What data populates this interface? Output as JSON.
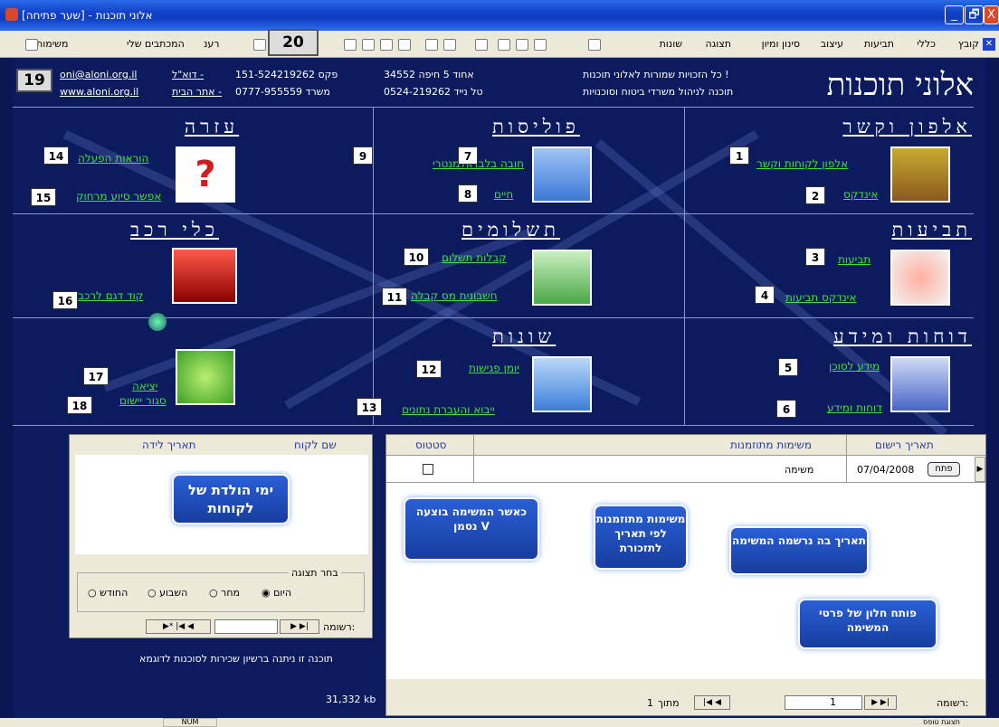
{
  "window": {
    "title": "[אלוני תוכנות - [שער פתיחה",
    "btn_min": "_",
    "btn_restore": "🗗",
    "btn_close": "X"
  },
  "toolbar": {
    "items": [
      "קובץ",
      "כללי",
      "תביעות",
      "עיצוב",
      "סינון ומיון",
      "תצוגה",
      "שונות"
    ],
    "my_forms": "המכתבים שלי",
    "reminders": "רענ",
    "tasks": "משימות",
    "badge20": "20",
    "badge19": "19"
  },
  "header": {
    "brand": "אלוני תוכנות",
    "slogan1": "כל הזכויות שמורות לאלוני תוכנות !",
    "slogan2": "תוכנה לניהול משרדי ביטוח וסוכנויות",
    "addr": "אחוד 5 חיפה  34552",
    "mobile": "טל נייד  0524-219262",
    "fax": "פקס  151-524219262",
    "office": "משרד  0777-955559",
    "email_lbl": "דוא\"ל -",
    "email": "oni@aloni.org.il",
    "site_lbl": "אתר הבית -",
    "site": "www.aloni.org.il"
  },
  "sections": {
    "alphon": {
      "title": "אלפון וקשר",
      "l1": "אלפון לקוחות וקשר",
      "l2": "אינדקס"
    },
    "policies": {
      "title": "פוליסות",
      "l1": "אלמנטרי",
      "l1b": "חובה בלבד",
      "l2": "חיים"
    },
    "help": {
      "title": "עזרה",
      "l1": "הוראות הפעלה",
      "l2": "אפשר סיוע מרחוק"
    },
    "claims": {
      "title": "תביעות",
      "l1": "תביעות",
      "l2": "אינדקס תביעות"
    },
    "payments": {
      "title": "תשלומים",
      "l1": "קבלות תשלום",
      "l2": "חשבונית מס קבלה"
    },
    "vehicles": {
      "title": "כלי רכב",
      "l1": "קוד דגם לרכב"
    },
    "reports": {
      "title": "דוחות ומידע",
      "l1": "מידע לסוכן",
      "l2": "דוחות ומידע"
    },
    "misc": {
      "title": "שונות",
      "l1": "יומן פגישות",
      "l2": "ייבוא והעברת נתונים"
    },
    "exit": {
      "l1": "יציאה",
      "l2": "סגור יישום"
    }
  },
  "markers": [
    "1",
    "2",
    "3",
    "4",
    "5",
    "6",
    "7",
    "8",
    "9",
    "10",
    "11",
    "12",
    "13",
    "14",
    "15",
    "16",
    "17",
    "18"
  ],
  "tasks_panel": {
    "cols": [
      "תאריך רישום",
      "משימות מתוזמנות",
      "סטטוס"
    ],
    "row": {
      "date": "07/04/2008",
      "open": "פתח",
      "task": "משימה"
    },
    "nav_label": "רשומה:",
    "nav_value": "1",
    "nav_of": "מתוך",
    "nav_total": "1"
  },
  "birthday_panel": {
    "cols": [
      "שם לקוח",
      "תאריך לידה"
    ],
    "group_label": "בחר תצוגה",
    "options": [
      "היום",
      "מחר",
      "השבוע",
      "החודש"
    ],
    "selected": "היום",
    "nav_label": "רשומה:",
    "note": "תוכנה זו ניתנה ברשיון שכירות לסוכנות לדוגמא",
    "size": "31,332  kb"
  },
  "callouts": {
    "birthdays": "ימי הולדת של לקוחות",
    "done": "כאשר המשימה בוצעה נסמן V",
    "scheduled": "משימות מתוזמנות לפי תאריך לתזכורת",
    "date_logged": "תאריך בה נרשמה המשימה",
    "opens": "פותח חלון של פרטי המשימה"
  },
  "statusbar": {
    "left": "תצוגת טופס",
    "num": "NUM"
  }
}
